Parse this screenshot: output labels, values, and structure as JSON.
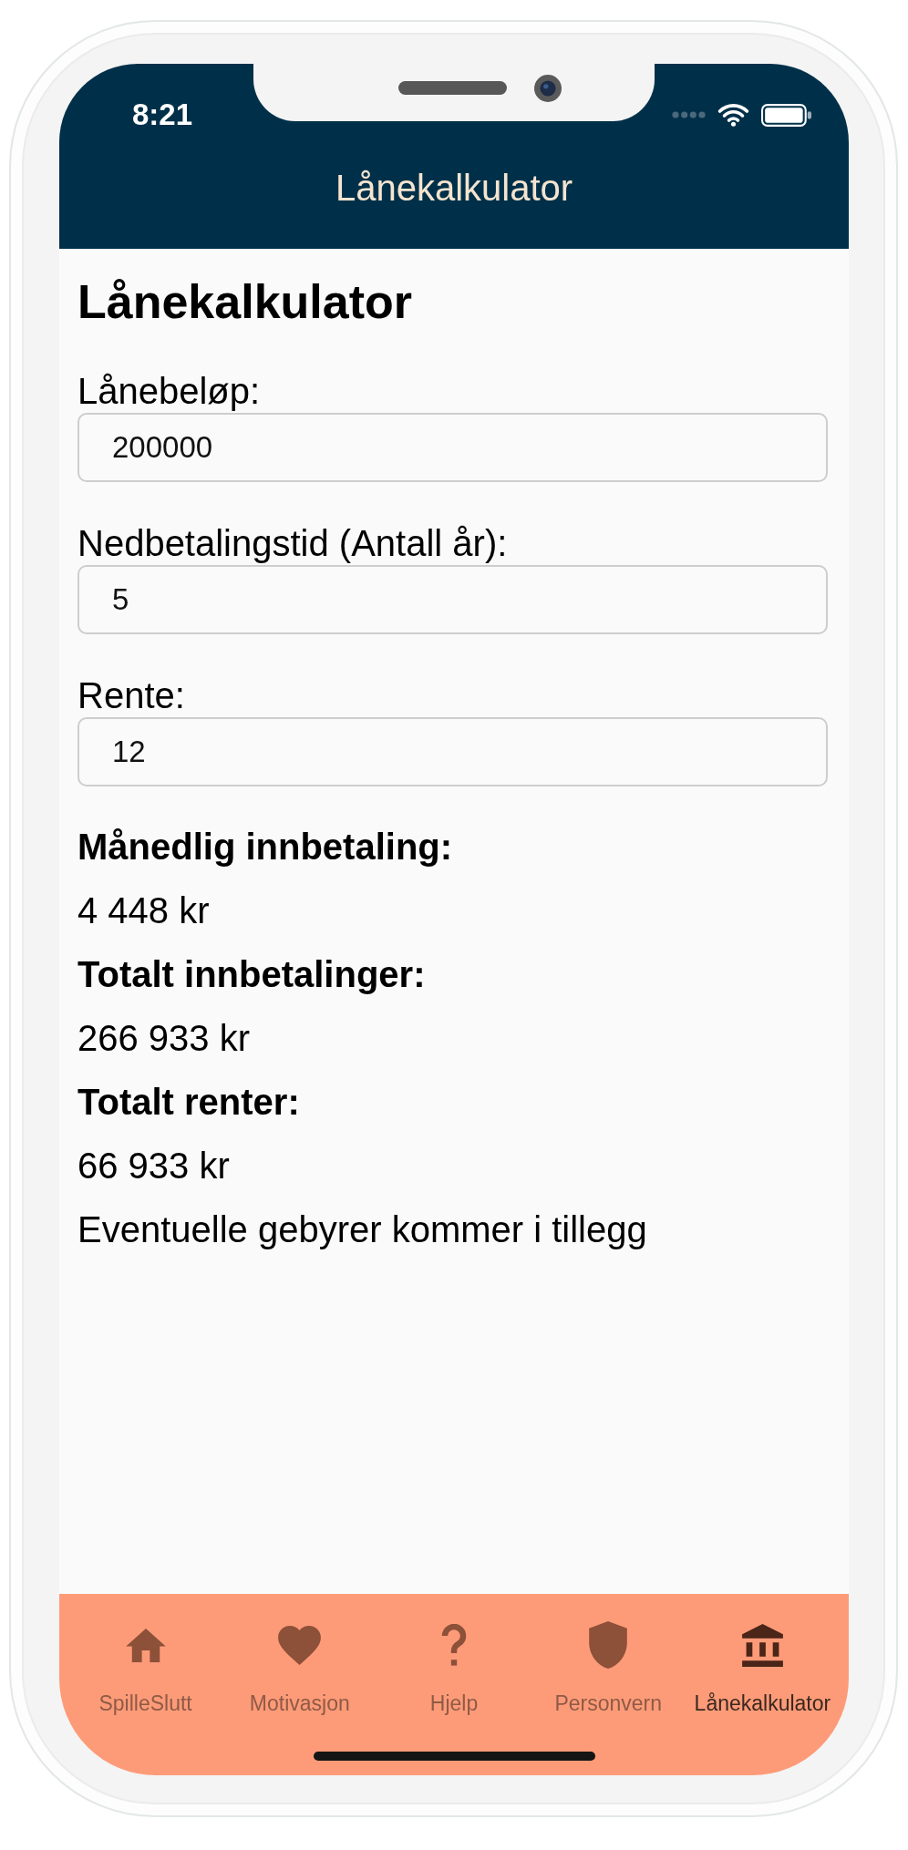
{
  "status_bar": {
    "time": "8:21"
  },
  "nav_bar": {
    "title": "Lånekalkulator"
  },
  "page": {
    "heading": "Lånekalkulator",
    "fields": [
      {
        "label": "Lånebeløp:",
        "value": "200000"
      },
      {
        "label": "Nedbetalingstid (Antall år):",
        "value": "5"
      },
      {
        "label": "Rente:",
        "value": "12"
      }
    ],
    "results": [
      {
        "label": "Månedlig innbetaling:",
        "value": "4 448 kr"
      },
      {
        "label": "Totalt innbetalinger:",
        "value": "266 933 kr"
      },
      {
        "label": "Totalt renter:",
        "value": "66 933 kr"
      }
    ],
    "note": "Eventuelle gebyrer kommer i tillegg"
  },
  "tab_bar": {
    "tabs": [
      {
        "label": "SpilleSlutt",
        "kind": "home",
        "selected": false
      },
      {
        "label": "Motivasjon",
        "kind": "heart",
        "selected": false
      },
      {
        "label": "Hjelp",
        "kind": "help",
        "selected": false
      },
      {
        "label": "Personvern",
        "kind": "shield",
        "selected": false
      },
      {
        "label": "Lånekalkulator",
        "kind": "bank",
        "selected": true
      }
    ]
  }
}
